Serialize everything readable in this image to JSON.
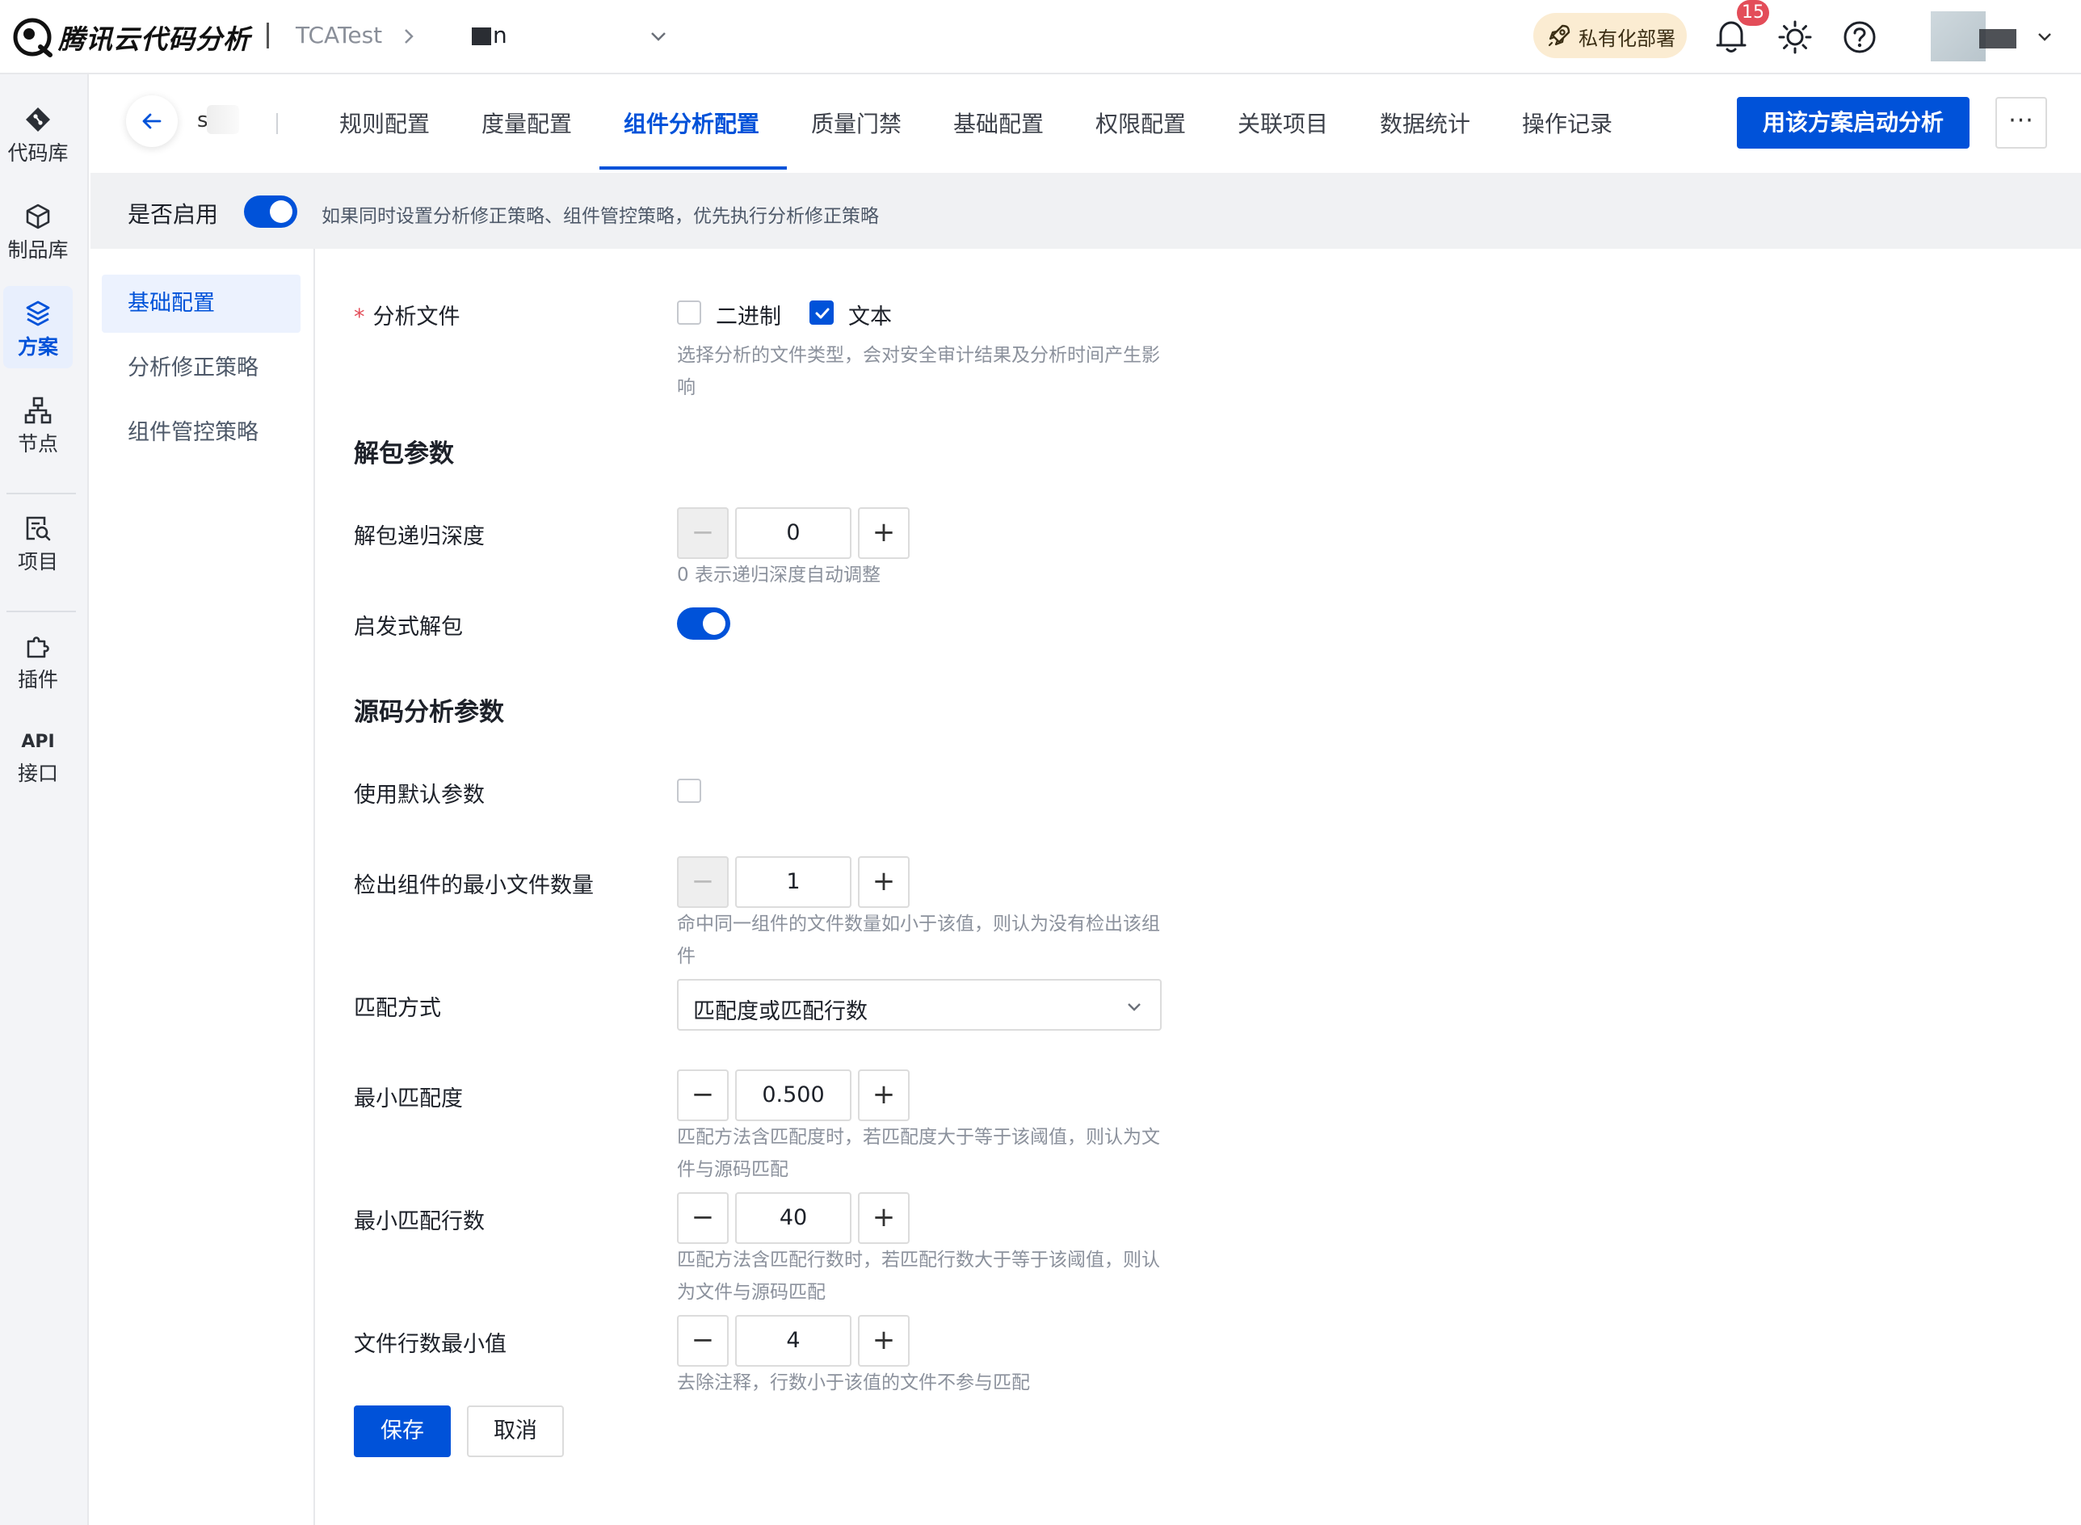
{
  "header": {
    "brand": "腾讯云代码分析",
    "team": "TCATest",
    "project": "n",
    "private_deploy": "私有化部署",
    "notification_count": "15"
  },
  "nav": {
    "items": [
      {
        "label": "代码库",
        "icon": "git-icon"
      },
      {
        "label": "制品库",
        "icon": "cube-icon"
      },
      {
        "label": "方案",
        "icon": "layers-icon",
        "active": true
      },
      {
        "label": "节点",
        "icon": "nodes-icon"
      },
      {
        "label": "项目",
        "icon": "project-search-icon"
      },
      {
        "label": "插件",
        "icon": "puzzle-icon"
      },
      {
        "label": "接口",
        "icon_text": "API"
      }
    ]
  },
  "scheme": {
    "name": "s"
  },
  "tabs": [
    "规则配置",
    "度量配置",
    "组件分析配置",
    "质量门禁",
    "基础配置",
    "权限配置",
    "关联项目",
    "数据统计",
    "操作记录"
  ],
  "active_tab": "组件分析配置",
  "actions": {
    "start": "用该方案启动分析",
    "more": "···"
  },
  "enable": {
    "label": "是否启用",
    "enabled": true,
    "hint": "如果同时设置分析修正策略、组件管控策略，优先执行分析修正策略"
  },
  "submenu": [
    "基础配置",
    "分析修正策略",
    "组件管控策略"
  ],
  "active_submenu": "基础配置",
  "form": {
    "analysis_files": {
      "required_mark": "*",
      "label": "分析文件",
      "options": [
        {
          "label": "二进制",
          "checked": false
        },
        {
          "label": "文本",
          "checked": true
        }
      ],
      "help": "选择分析的文件类型，会对安全审计结果及分析时间产生影响"
    },
    "unpack_section": "解包参数",
    "recursion_depth": {
      "label": "解包递归深度",
      "value": "0",
      "help": "0 表示递归深度自动调整"
    },
    "heuristic_unpack": {
      "label": "启发式解包",
      "enabled": true
    },
    "source_section": "源码分析参数",
    "use_default": {
      "label": "使用默认参数",
      "checked": false
    },
    "min_files": {
      "label": "检出组件的最小文件数量",
      "value": "1",
      "help": "命中同一组件的文件数量如小于该值，则认为没有检出该组件"
    },
    "match_method": {
      "label": "匹配方式",
      "value": "匹配度或匹配行数"
    },
    "min_similarity": {
      "label": "最小匹配度",
      "value": "0.500",
      "help": "匹配方法含匹配度时，若匹配度大于等于该阈值，则认为文件与源码匹配"
    },
    "min_lines": {
      "label": "最小匹配行数",
      "value": "40",
      "help": "匹配方法含匹配行数时，若匹配行数大于等于该阈值，则认为文件与源码匹配"
    },
    "file_min_lines": {
      "label": "文件行数最小值",
      "value": "4",
      "help": "去除注释，行数小于该值的文件不参与匹配"
    },
    "save": "保存",
    "cancel": "取消"
  },
  "colors": {
    "primary": "#0052d9",
    "danger": "#e34d59",
    "banner": "#f0f1f3",
    "deploy_badge": "#fbecd2"
  }
}
